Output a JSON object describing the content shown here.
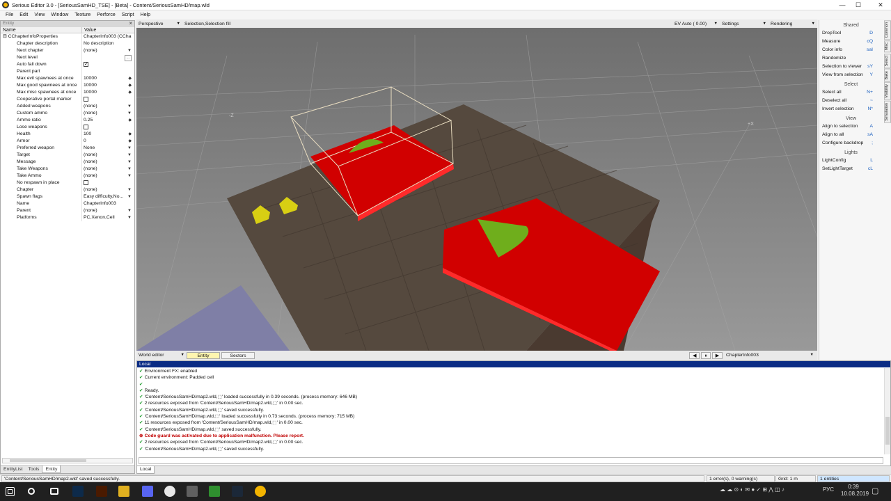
{
  "window": {
    "title": "Serious Editor 3.0 - [SeriousSamHD_TSE] - [Beta] - Content/SeriousSamHD/map.wld",
    "minimize": "—",
    "maximize": "☐",
    "close": "✕"
  },
  "menu": [
    "File",
    "Edit",
    "View",
    "Window",
    "Texture",
    "Perforce",
    "Script",
    "Help"
  ],
  "left_panel": {
    "header": "Entity",
    "close": "×",
    "columns": {
      "name": "Name",
      "value": "Value"
    },
    "root": {
      "expander": "⊟",
      "name": "CChapterInfoProperties",
      "value": "ChapterInfo003 (CCha"
    },
    "properties": [
      {
        "name": "Chapter description",
        "value": "No description",
        "control": ""
      },
      {
        "name": "Next chapter",
        "value": "(none)",
        "control": "dropdown"
      },
      {
        "name": "Next level",
        "value": "",
        "control": "browse"
      },
      {
        "name": "Auto fall down",
        "value": "",
        "control": "checkbox-checked"
      },
      {
        "name": "Parent part",
        "value": "",
        "control": ""
      },
      {
        "name": "Max evil spawnees at once",
        "value": "10000",
        "control": "spin"
      },
      {
        "name": "Max good spawnees at once",
        "value": "10000",
        "control": "spin"
      },
      {
        "name": "Max misc spawnees at once",
        "value": "10000",
        "control": "spin"
      },
      {
        "name": "Cooperative portal marker",
        "value": "",
        "control": "checkbox"
      },
      {
        "name": "Added weapons",
        "value": "(none)",
        "control": "dropdown"
      },
      {
        "name": "Custom ammo",
        "value": "(none)",
        "control": "dropdown"
      },
      {
        "name": "Ammo ratio",
        "value": "0.25",
        "control": "spin"
      },
      {
        "name": "Lose weapons",
        "value": "",
        "control": "checkbox"
      },
      {
        "name": "Health",
        "value": "100",
        "control": "spin"
      },
      {
        "name": "Armor",
        "value": "0",
        "control": "spin"
      },
      {
        "name": "Preferred weapon",
        "value": "None",
        "control": "dropdown"
      },
      {
        "name": "Target",
        "value": "(none)",
        "control": "dropdown"
      },
      {
        "name": "Message",
        "value": "(none)",
        "control": "dropdown"
      },
      {
        "name": "Take Weapons",
        "value": "(none)",
        "control": "dropdown"
      },
      {
        "name": "Take Ammo",
        "value": "(none)",
        "control": "dropdown"
      },
      {
        "name": "No respawn in place",
        "value": "",
        "control": "checkbox"
      },
      {
        "name": "Chapter",
        "value": "(none)",
        "control": "dropdown"
      },
      {
        "name": "Spawn flags",
        "value": "Easy difficulty,No...",
        "control": "dropdown"
      },
      {
        "name": "Name",
        "value": "ChapterInfo003",
        "control": ""
      },
      {
        "name": "Parent",
        "value": "(none)",
        "control": "dropdown"
      },
      {
        "name": "Platforms",
        "value": "PC,Xenon,Cell",
        "control": "dropdown"
      }
    ],
    "tabs": [
      "EntityList",
      "Tools",
      "Entity"
    ],
    "active_tab": "Entity"
  },
  "viewport_toolbar": {
    "view_mode": "Perspective",
    "selection_mode": "Selection,Selection fill",
    "exposure": "EV Auto ( 0.00)",
    "settings": "Settings",
    "rendering": "Rendering"
  },
  "viewport": {
    "axis_labels": [
      "-Z",
      "+X"
    ],
    "colors": {
      "floor": "#55493e",
      "red_box": "#d10000",
      "cone": "#6fae1c",
      "marker": "#d8cf13",
      "background": "#8b8b8b"
    }
  },
  "viewport_bottom": {
    "editor_mode": "World editor",
    "tab_entity": "Entity",
    "tab_sectors": "Sectors",
    "play_prev": "◀",
    "play_pause": "⏸",
    "play_next": "▶",
    "selected_entity": "ChapterInfo003"
  },
  "right_panel": {
    "sections": [
      {
        "title": "Shared",
        "items": [
          {
            "label": "DropTool",
            "key": "D"
          },
          {
            "label": "Measure",
            "key": "cQ"
          },
          {
            "label": "Color info",
            "key": "saI"
          },
          {
            "label": "Randomize",
            "key": ""
          },
          {
            "label": "Selection to viewer",
            "key": "sY"
          },
          {
            "label": "View from selection",
            "key": "Y"
          }
        ]
      },
      {
        "title": "Select",
        "items": [
          {
            "label": "Select all",
            "key": "N+"
          },
          {
            "label": "Deselect all",
            "key": "~"
          },
          {
            "label": "Invert selection",
            "key": "N*"
          }
        ]
      },
      {
        "title": "View",
        "items": [
          {
            "label": "Align to selection",
            "key": "A"
          },
          {
            "label": "Align to all",
            "key": "sA"
          },
          {
            "label": "Configure backdrop",
            "key": ";"
          }
        ]
      },
      {
        "title": "Lights",
        "items": [
          {
            "label": "LightConfig",
            "key": "L"
          },
          {
            "label": "SetLightTarget",
            "key": "cL"
          }
        ]
      }
    ],
    "vertical_tabs": [
      "Common",
      "Misc",
      "Select",
      "Bake",
      "Visibility",
      "Simulation"
    ]
  },
  "log": {
    "header": "Local",
    "lines": [
      {
        "type": "ok",
        "text": "Environment FX: enabled"
      },
      {
        "type": "ok",
        "text": "Current environment: Padded cell"
      },
      {
        "type": "ok",
        "text": ""
      },
      {
        "type": "ok",
        "text": "Ready."
      },
      {
        "type": "ok",
        "text": "'Content/SeriousSamHD/map2.wld,⬚' loaded successfully in 0.39 seconds. (process memory: 646 MB)"
      },
      {
        "type": "ok",
        "text": "2 resources exposed from 'Content/SeriousSamHD/map2.wld,⬚' in 0.00 sec."
      },
      {
        "type": "ok",
        "text": "'Content/SeriousSamHD/map2.wld,⬚' saved successfully."
      },
      {
        "type": "ok",
        "text": "'Content/SeriousSamHD/map.wld,⬚' loaded successfully in 0.73 seconds. (process memory: 715 MB)"
      },
      {
        "type": "ok",
        "text": "11 resources exposed from 'Content/SeriousSamHD/map.wld,⬚' in 0.00 sec."
      },
      {
        "type": "ok",
        "text": "'Content/SeriousSamHD/map.wld,⬚' saved successfully."
      },
      {
        "type": "err",
        "text": "Code guard was activated due to application malfunction. Please report."
      },
      {
        "type": "ok",
        "text": "2 resources exposed from 'Content/SeriousSamHD/map2.wld,⬚' in 0.00 sec."
      },
      {
        "type": "ok",
        "text": "'Content/SeriousSamHD/map2.wld,⬚' saved successfully."
      }
    ],
    "tab": "Local"
  },
  "status_bar": {
    "message": "'Content/SeriousSamHD/map2.wld' saved successfully.",
    "errors": "1 error(s), 0 warning(s)",
    "grid": "Grid: 1 m",
    "entities": "1 entities"
  },
  "taskbar": {
    "apps": [
      "windows-start",
      "search",
      "task-view",
      "photoshop",
      "illustrator",
      "file-explorer",
      "discord",
      "chrome",
      "calculator",
      "notepad",
      "steam",
      "serious-editor"
    ],
    "tray_lang": "РУС",
    "time": "0:39",
    "date": "10.08.2019"
  }
}
